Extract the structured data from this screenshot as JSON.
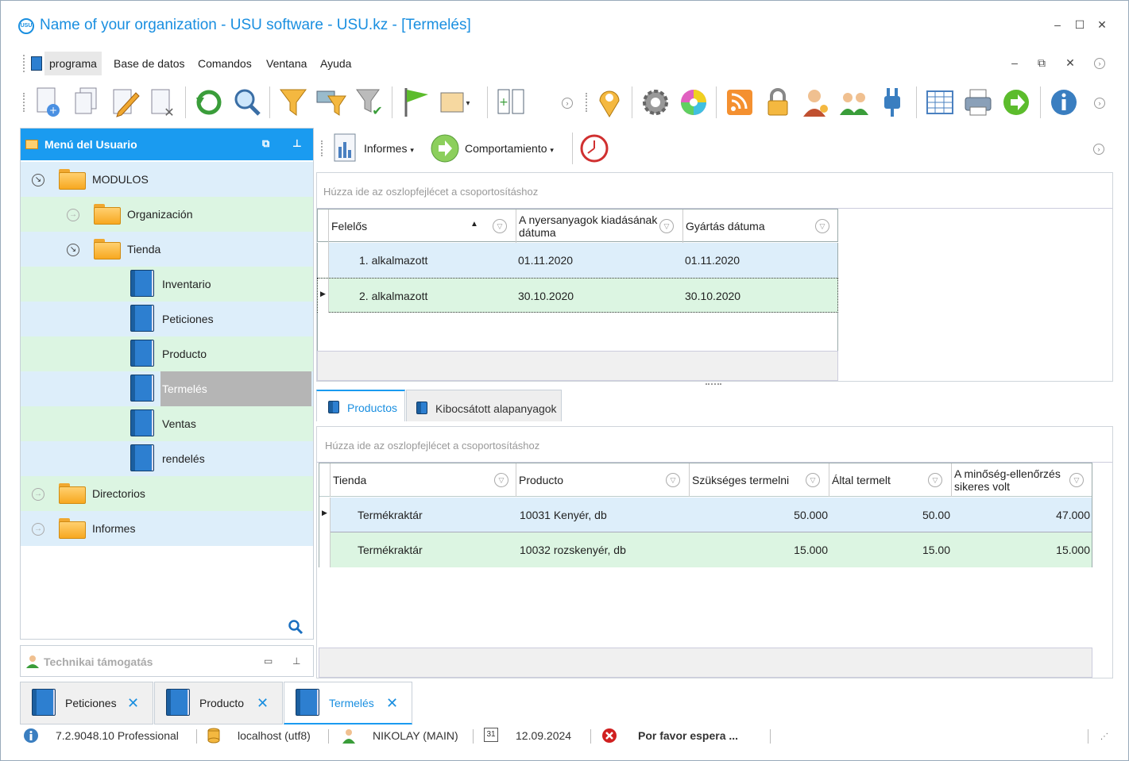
{
  "window": {
    "app_icon_text": "USU",
    "title": "Name of your organization - USU software - USU.kz - [Termelés]",
    "minimize": "–",
    "maximize": "☐",
    "close": "✕"
  },
  "menubar": {
    "items": [
      "programa",
      "Base de datos",
      "Comandos",
      "Ventana",
      "Ayuda"
    ],
    "controls": {
      "minimize": "–",
      "restore": "⧉",
      "close": "✕"
    }
  },
  "toolbar": {
    "icons": [
      "new-document-icon",
      "copy-icon",
      "edit-icon",
      "delete-icon",
      "refresh-icon",
      "search-icon",
      "filter-icon",
      "filter-edit-icon",
      "filter-apply-icon",
      "flag-icon",
      "image-icon",
      "columns-icon",
      "location-pin-icon",
      "settings-icon",
      "color-wheel-icon",
      "rss-icon",
      "lock-icon",
      "user-key-icon",
      "users-icon",
      "plugin-icon",
      "table-icon",
      "print-icon",
      "forward-icon",
      "info-icon"
    ]
  },
  "left_panel": {
    "title": "Menú del Usuario",
    "tree": [
      {
        "label": "MODULOS",
        "type": "folder",
        "level": 0,
        "expanded": true
      },
      {
        "label": "Organización",
        "type": "folder",
        "level": 1,
        "expanded": false
      },
      {
        "label": "Tienda",
        "type": "folder",
        "level": 1,
        "expanded": true
      },
      {
        "label": "Inventario",
        "type": "book",
        "level": 2
      },
      {
        "label": "Peticiones",
        "type": "book",
        "level": 2
      },
      {
        "label": "Producto",
        "type": "book",
        "level": 2
      },
      {
        "label": "Termelés",
        "type": "book",
        "level": 2,
        "selected": true
      },
      {
        "label": "Ventas",
        "type": "book",
        "level": 2
      },
      {
        "label": "rendelés",
        "type": "book",
        "level": 2
      },
      {
        "label": "Directorios",
        "type": "folder",
        "level": 0,
        "expanded": false
      },
      {
        "label": "Informes",
        "type": "folder",
        "level": 0,
        "expanded": false
      }
    ]
  },
  "support_panel": {
    "title": "Technikai támogatás"
  },
  "sub_toolbar": {
    "reports_label": "Informes",
    "behavior_label": "Comportamiento"
  },
  "upper_grid": {
    "group_hint": "Húzza ide az oszlopfejlécet a csoportosításhoz",
    "columns": [
      "Felelős",
      "A nyersanyagok kiadásának dátuma",
      "Gyártás dátuma"
    ],
    "rows": [
      [
        "1. alkalmazott",
        "01.11.2020",
        "01.11.2020"
      ],
      [
        "2. alkalmazott",
        "30.10.2020",
        "30.10.2020"
      ]
    ]
  },
  "tabs": [
    "Productos",
    "Kibocsátott alapanyagok"
  ],
  "lower_grid": {
    "group_hint": "Húzza ide az oszlopfejlécet a csoportosításhoz",
    "columns": [
      "Tienda",
      "Producto",
      "Szükséges termelni",
      "Által termelt",
      "A minőség-ellenőrzés sikeres volt"
    ],
    "rows": [
      [
        "Termékraktár",
        "10031 Kenyér, db",
        "50.000",
        "50.00",
        "47.000"
      ],
      [
        "Termékraktár",
        "10032 rozskenyér, db",
        "15.000",
        "15.00",
        "15.000"
      ]
    ]
  },
  "doc_tabs": [
    "Peticiones",
    "Producto",
    "Termelés"
  ],
  "status_bar": {
    "version": "7.2.9048.10 Professional",
    "db": "localhost (utf8)",
    "user": "NIKOLAY (MAIN)",
    "calendar_day": "31",
    "date": "12.09.2024",
    "message": "Por favor espera ..."
  },
  "colors": {
    "accent": "#1a9bf0",
    "row_blue": "#ddeefa",
    "row_green": "#dcf5e2",
    "selected": "#b5b5b5"
  }
}
